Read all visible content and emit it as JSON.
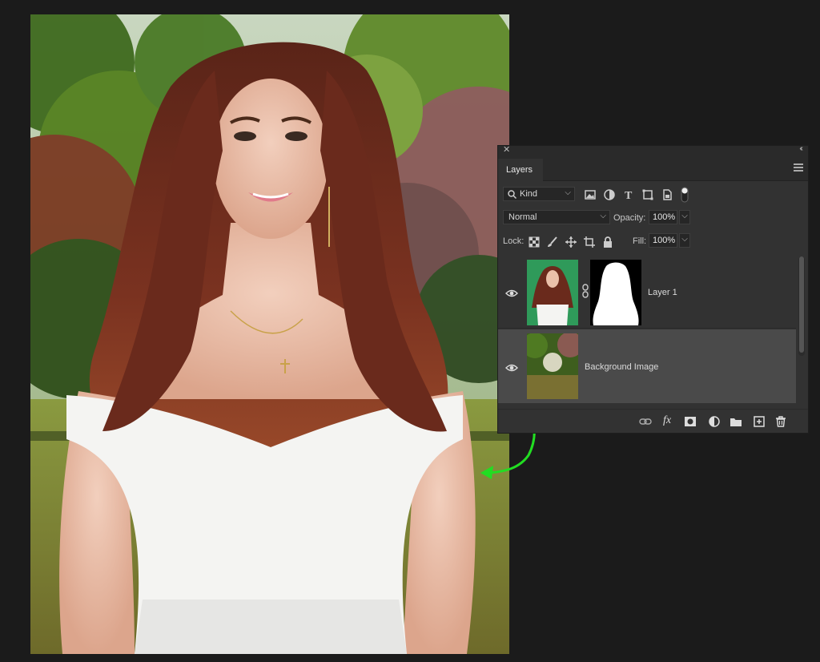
{
  "panel": {
    "tab_label": "Layers",
    "close_glyph": "✕",
    "collapse_glyph": "‹‹",
    "filter": {
      "value": "Kind",
      "icons": [
        "image-filter-icon",
        "adjustment-filter-icon",
        "type-filter-icon",
        "shape-filter-icon",
        "smart-object-filter-icon",
        "filter-toggle-icon"
      ]
    },
    "blend_mode": "Normal",
    "opacity_label": "Opacity:",
    "opacity_value": "100%",
    "lock_label": "Lock:",
    "lock_icons": [
      "lock-transparent-icon",
      "lock-image-icon",
      "lock-position-icon",
      "lock-artboard-icon",
      "lock-all-icon"
    ],
    "fill_label": "Fill:",
    "fill_value": "100%",
    "layers": [
      {
        "name": "Layer 1",
        "visible": true,
        "has_mask": true,
        "selected": false
      },
      {
        "name": "Background Image",
        "visible": true,
        "has_mask": false,
        "selected": true
      }
    ],
    "footer_icons": [
      "link-layers-icon",
      "fx-icon",
      "add-mask-icon",
      "adjustment-layer-icon",
      "new-group-icon",
      "new-layer-icon",
      "delete-layer-icon"
    ],
    "fx_label": "fx"
  },
  "annotation": {
    "highlight_color": "#22dd22"
  }
}
